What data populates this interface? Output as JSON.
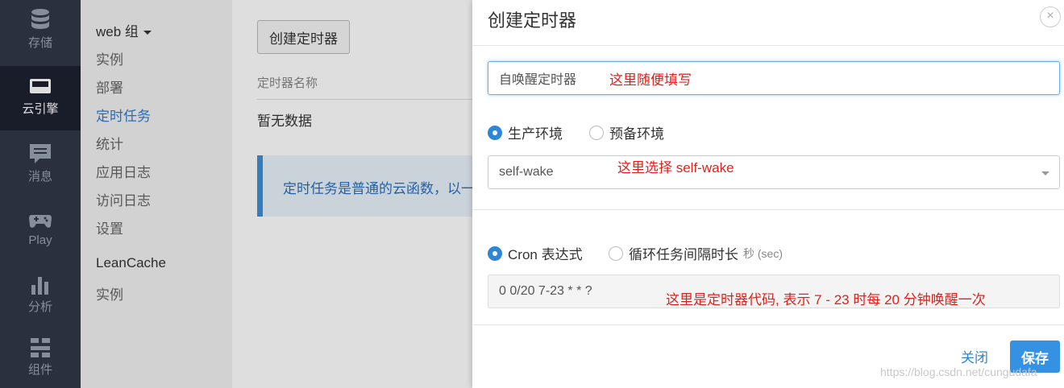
{
  "iconbar": {
    "items": [
      {
        "label": "存储",
        "icon": "database-icon"
      },
      {
        "label": "云引擎",
        "icon": "server-icon",
        "active": true
      },
      {
        "label": "消息",
        "icon": "message-icon"
      },
      {
        "label": "Play",
        "icon": "gamepad-icon"
      },
      {
        "label": "分析",
        "icon": "bar-chart-icon"
      },
      {
        "label": "组件",
        "icon": "components-icon"
      }
    ]
  },
  "subnav": {
    "group1": "web 组",
    "items1": [
      "实例",
      "部署",
      "定时任务",
      "统计",
      "应用日志",
      "访问日志",
      "设置"
    ],
    "active_item": "定时任务",
    "group2": "LeanCache",
    "items2": [
      "实例"
    ]
  },
  "main": {
    "create_button": "创建定时器",
    "column_header": "定时器名称",
    "empty_text": "暂无数据",
    "info_text": "定时任务是普通的云函数，以一"
  },
  "modal": {
    "title": "创建定时器",
    "close": "×",
    "name_value": "自唤醒定时器",
    "name_note": "这里随便填写",
    "env_options": [
      "生产环境",
      "预备环境"
    ],
    "env_selected": "生产环境",
    "function_value": "self-wake",
    "function_note": "这里选择 self-wake",
    "type_options": [
      "Cron 表达式",
      "循环任务间隔时长"
    ],
    "type_hint": "秒 (sec)",
    "type_selected": "Cron 表达式",
    "cron_value": "0 0/20 7-23 * * ?",
    "cron_note": "这里是定时器代码, 表示 7 - 23 时每 20 分钟唤醒一次",
    "cancel": "关闭",
    "save": "保存"
  },
  "watermark": "https://blog.csdn.net/cungudafa",
  "colors": {
    "accent": "#3592e3",
    "annotation": "#e3211b",
    "sidebar": "#313847"
  }
}
